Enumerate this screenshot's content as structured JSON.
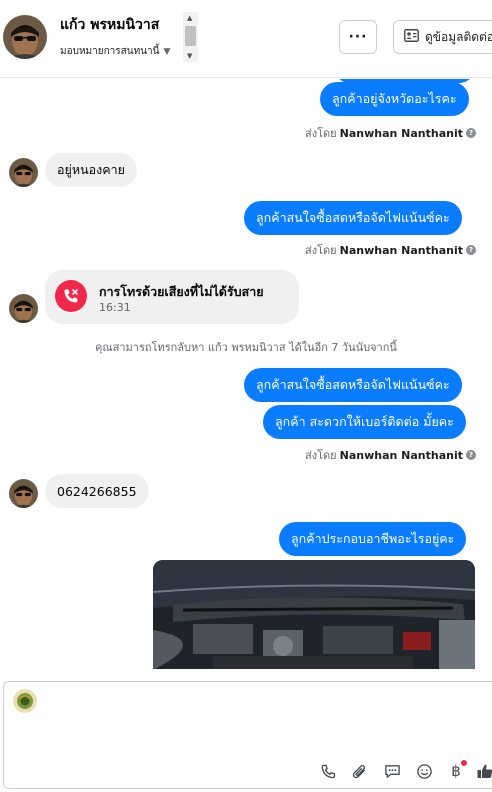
{
  "header": {
    "contact_name": "แก้ว พรหมนิวาส",
    "assign_label": "มอบหมายการสนทนานี้",
    "more_label": "···",
    "contact_info_label": "ดูข้อมูลติดต่อ"
  },
  "messages": {
    "out_1": "ลูกค้าอยู่จังหวัดอะไรคะ",
    "sent_by_prefix": "ส่งโดย",
    "sent_by_name": "Nanwhan Nanthanit",
    "in_1": "อยู่หนองคาย",
    "out_2": "ลูกค้าสนใจซื้อสดหรือจัดไฟแน้นซ์คะ",
    "call_title": "การโทรด้วยเสียงที่ไม่ได้รับสาย",
    "call_time": "16:31",
    "call_back_notice": "คุณสามารถโทรกลับหา แก้ว พรหมนิวาส ได้ในอีก 7 วันนับจากนี้",
    "out_3": "ลูกค้าสนใจซื้อสดหรือจัดไฟแน้นซ์คะ",
    "out_4": "ลูกค้า สะดวกให้เบอร์ติดต่อ มั้ยคะ",
    "in_2": "0624266855",
    "out_5": "ลูกค้าประกอบอาชีพอะไรอยู่คะ"
  },
  "composer": {
    "value": ""
  },
  "colors": {
    "outgoing_bubble": "#0a7cff",
    "incoming_bubble": "#f0f0f0",
    "missed_call": "#f02849"
  }
}
